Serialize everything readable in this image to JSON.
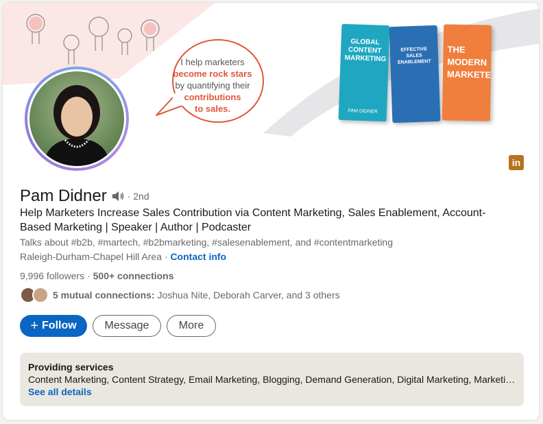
{
  "banner": {
    "bubble_line1": "I help marketers",
    "bubble_line2": "become rock stars",
    "bubble_line3": "by quantifying their",
    "bubble_line4": "contributions",
    "bubble_line5": "to sales.",
    "books": [
      {
        "title": "GLOBAL CONTENT MARKETING",
        "author": "PAM DIDNER"
      },
      {
        "title": "EFFECTIVE SALES ENABLEMENT"
      },
      {
        "title": "THE MODERN MARKETER"
      }
    ],
    "linkedin_icon": "linkedin-icon",
    "accent_color": "#e1553c"
  },
  "profile": {
    "name": "Pam Didner",
    "degree": "· 2nd",
    "headline": "Help Marketers Increase Sales Contribution via Content Marketing, Sales Enablement, Account-Based Marketing | Speaker | Author | Podcaster",
    "talks_about": "Talks about #b2b, #martech, #b2bmarketing, #salesenablement, and #contentmarketing",
    "location": "Raleigh-Durham-Chapel Hill Area",
    "location_sep": " · ",
    "contact_info": "Contact info",
    "followers": "9,996 followers",
    "stats_sep": " · ",
    "connections": "500+ connections",
    "mutual_bold": "5 mutual connections:",
    "mutual_rest": " Joshua Nite, Deborah Carver, and 3 others"
  },
  "actions": {
    "follow_icon": "+",
    "follow_label": "Follow",
    "message_label": "Message",
    "more_label": "More"
  },
  "services": {
    "title": "Providing services",
    "list": "Content Marketing, Content Strategy, Email Marketing, Blogging, Demand Generation, Digital Marketing, Marketing Strategy",
    "link": "See all details"
  },
  "colors": {
    "primary": "#0a66c2",
    "services_bg": "#eae6e0"
  }
}
